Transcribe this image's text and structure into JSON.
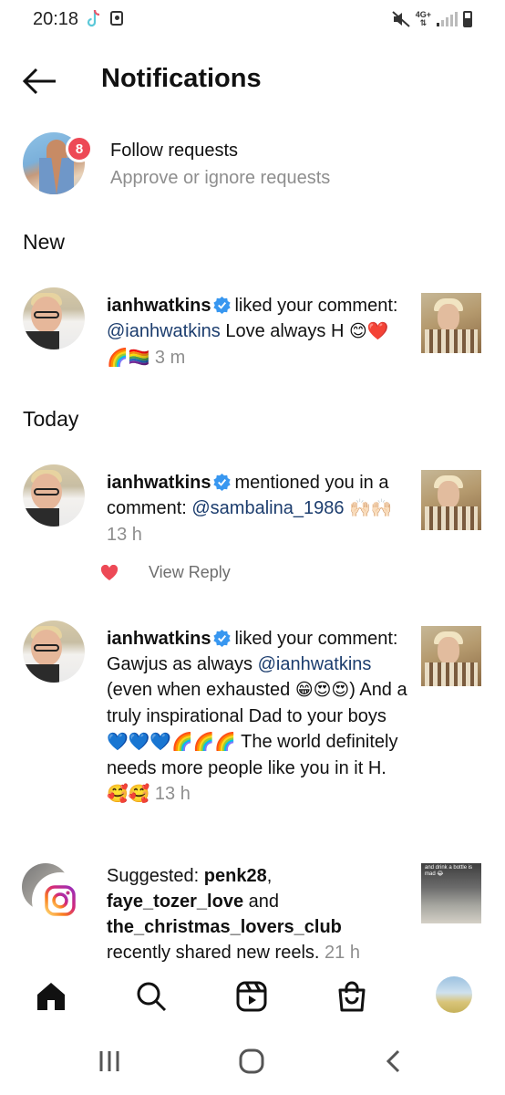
{
  "status_bar": {
    "time": "20:18",
    "network": "4G+"
  },
  "header": {
    "title": "Notifications"
  },
  "follow_requests": {
    "count": "8",
    "title": "Follow requests",
    "subtitle": "Approve or ignore requests"
  },
  "sections": {
    "new": "New",
    "today": "Today"
  },
  "notifications": [
    {
      "user": "ianhwatkins",
      "action": "liked your comment:",
      "mention": "@ianhwatkins",
      "body": "Love always H",
      "emojis": "😊❤️🌈🏳️‍🌈",
      "time": "3 m"
    },
    {
      "user": "ianhwatkins",
      "action": "mentioned you in a comment:",
      "mention": "@sambalina_1986",
      "emojis": "🙌🏻🙌🏻",
      "time": "13 h",
      "view_reply": "View Reply"
    },
    {
      "user": "ianhwatkins",
      "action": "liked your comment:",
      "body_start": "Gawjus as always",
      "mention": "@ianhwatkins",
      "body_mid": "(even when exhausted",
      "emojis_1": "😁😍😍",
      "body_end": ") And a truly inspirational Dad to your boys",
      "emojis_2": "💙💙💙🌈🌈🌈",
      "body_tail": "The world definitely needs more people like you in it H.",
      "emojis_3": "🥰🥰",
      "time": "13 h"
    },
    {
      "prefix": "Suggested:",
      "user_1": "penk28",
      "user_2": "faye_tozer_love",
      "joiner": "and",
      "user_3": "the_christmas_lovers_club",
      "body": "recently shared new reels.",
      "time": "21 h",
      "thumb_caption": "and drink a bottle is mad 😂"
    }
  ],
  "bottom_nav": [
    "home-icon",
    "search-icon",
    "reels-icon",
    "shop-icon",
    "profile-avatar"
  ],
  "system_nav": [
    "recents-icon",
    "home-icon",
    "back-icon"
  ],
  "colors": {
    "badge": "#ed4956",
    "verified": "#3897f0",
    "mention": "#1c3d6e",
    "secondary_text": "#8e8e8e"
  }
}
